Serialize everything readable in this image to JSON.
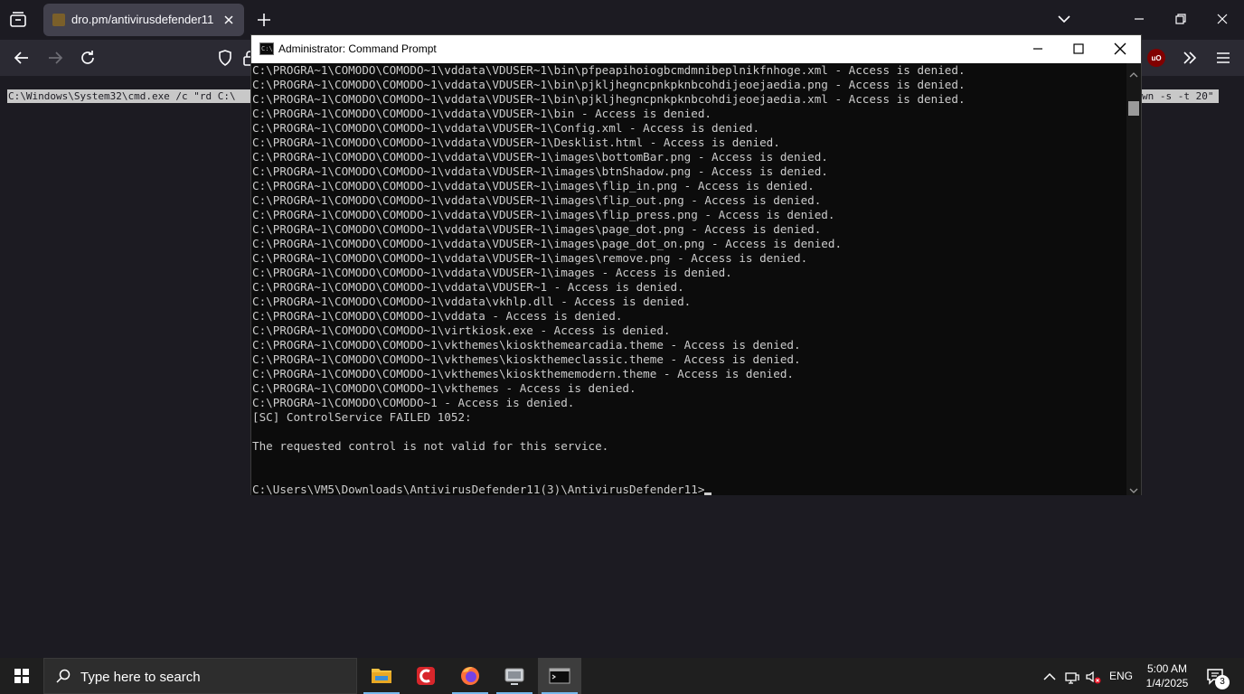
{
  "browser": {
    "tab_title": "dro.pm/antivirusdefender11"
  },
  "page": {
    "selected_cmd_left": "C:\\Windows\\System32\\cmd.exe /c \"rd C:\\",
    "selected_cmd_right": "wn -s -t 20\""
  },
  "cmd_window": {
    "title": "Administrator: Command Prompt",
    "lines": [
      "C:\\PROGRA~1\\COMODO\\COMODO~1\\vddata\\VDUSER~1\\bin\\pfpeapihoiogbcmdmnibeplnikfnhoge.xml - Access is denied.",
      "C:\\PROGRA~1\\COMODO\\COMODO~1\\vddata\\VDUSER~1\\bin\\pjkljhegncpnkpknbcohdijeoejaedia.png - Access is denied.",
      "C:\\PROGRA~1\\COMODO\\COMODO~1\\vddata\\VDUSER~1\\bin\\pjkljhegncpnkpknbcohdijeoejaedia.xml - Access is denied.",
      "C:\\PROGRA~1\\COMODO\\COMODO~1\\vddata\\VDUSER~1\\bin - Access is denied.",
      "C:\\PROGRA~1\\COMODO\\COMODO~1\\vddata\\VDUSER~1\\Config.xml - Access is denied.",
      "C:\\PROGRA~1\\COMODO\\COMODO~1\\vddata\\VDUSER~1\\Desklist.html - Access is denied.",
      "C:\\PROGRA~1\\COMODO\\COMODO~1\\vddata\\VDUSER~1\\images\\bottomBar.png - Access is denied.",
      "C:\\PROGRA~1\\COMODO\\COMODO~1\\vddata\\VDUSER~1\\images\\btnShadow.png - Access is denied.",
      "C:\\PROGRA~1\\COMODO\\COMODO~1\\vddata\\VDUSER~1\\images\\flip_in.png - Access is denied.",
      "C:\\PROGRA~1\\COMODO\\COMODO~1\\vddata\\VDUSER~1\\images\\flip_out.png - Access is denied.",
      "C:\\PROGRA~1\\COMODO\\COMODO~1\\vddata\\VDUSER~1\\images\\flip_press.png - Access is denied.",
      "C:\\PROGRA~1\\COMODO\\COMODO~1\\vddata\\VDUSER~1\\images\\page_dot.png - Access is denied.",
      "C:\\PROGRA~1\\COMODO\\COMODO~1\\vddata\\VDUSER~1\\images\\page_dot_on.png - Access is denied.",
      "C:\\PROGRA~1\\COMODO\\COMODO~1\\vddata\\VDUSER~1\\images\\remove.png - Access is denied.",
      "C:\\PROGRA~1\\COMODO\\COMODO~1\\vddata\\VDUSER~1\\images - Access is denied.",
      "C:\\PROGRA~1\\COMODO\\COMODO~1\\vddata\\VDUSER~1 - Access is denied.",
      "C:\\PROGRA~1\\COMODO\\COMODO~1\\vddata\\vkhlp.dll - Access is denied.",
      "C:\\PROGRA~1\\COMODO\\COMODO~1\\vddata - Access is denied.",
      "C:\\PROGRA~1\\COMODO\\COMODO~1\\virtkiosk.exe - Access is denied.",
      "C:\\PROGRA~1\\COMODO\\COMODO~1\\vkthemes\\kioskthemearcadia.theme - Access is denied.",
      "C:\\PROGRA~1\\COMODO\\COMODO~1\\vkthemes\\kioskthemeclassic.theme - Access is denied.",
      "C:\\PROGRA~1\\COMODO\\COMODO~1\\vkthemes\\kioskthememodern.theme - Access is denied.",
      "C:\\PROGRA~1\\COMODO\\COMODO~1\\vkthemes - Access is denied.",
      "C:\\PROGRA~1\\COMODO\\COMODO~1 - Access is denied.",
      "[SC] ControlService FAILED 1052:",
      "",
      "The requested control is not valid for this service.",
      "",
      ""
    ],
    "prompt": "C:\\Users\\VM5\\Downloads\\AntivirusDefender11(3)\\AntivirusDefender11>"
  },
  "taskbar": {
    "search_placeholder": "Type here to search",
    "language": "ENG",
    "time": "5:00 AM",
    "date": "1/4/2025",
    "notification_count": "3"
  },
  "colors": {
    "accent": "#76b9ed",
    "console_bg": "#0c0c0c",
    "console_text": "#cccccc"
  }
}
